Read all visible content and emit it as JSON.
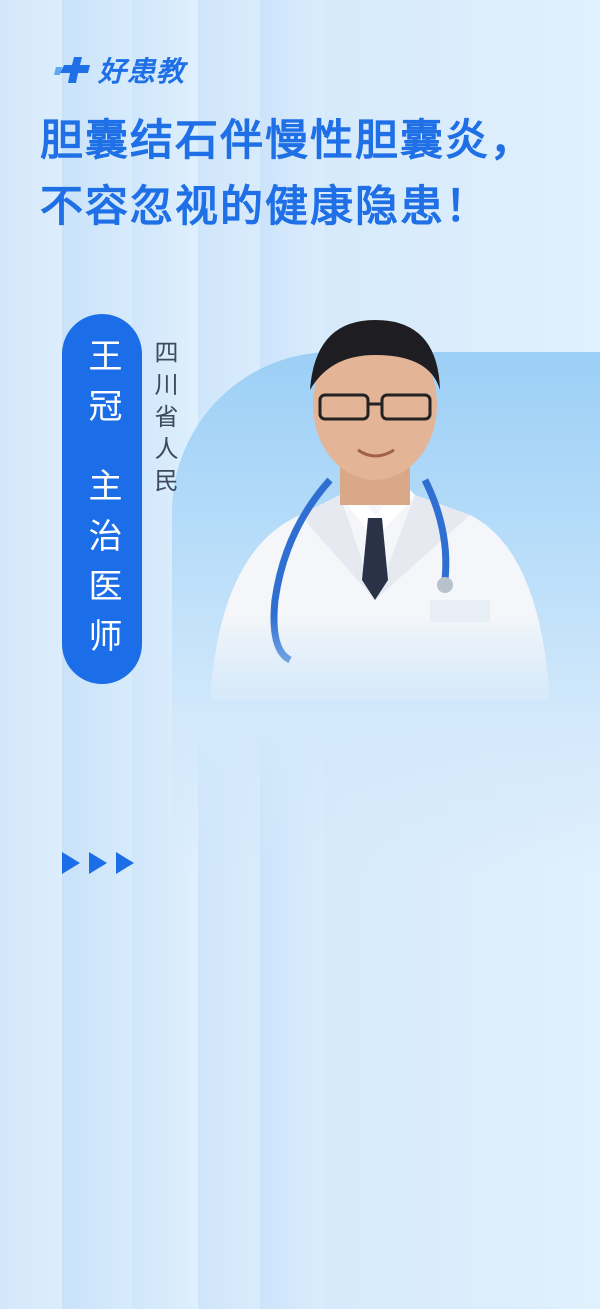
{
  "brand": {
    "name": "好患教",
    "color": "#1f6fe6"
  },
  "title": "胆囊结石伴慢性胆囊炎，不容忽视的健康隐患！",
  "doctor": {
    "name": "王冠",
    "position": "主治医师",
    "hospital": "四川省人民",
    "photo_icon": "doctor-portrait-icon"
  },
  "decor": {
    "arrows_icon": "triple-play-arrows-icon",
    "accent": "#1c6ee8"
  }
}
